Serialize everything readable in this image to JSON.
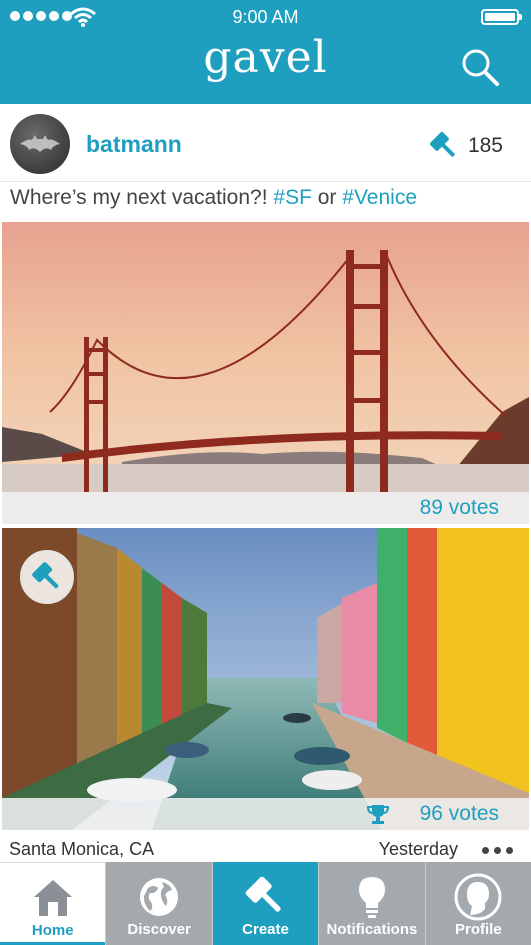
{
  "status_bar": {
    "time": "9:00 AM"
  },
  "app": {
    "name": "gavel",
    "accent": "#1e9fbf"
  },
  "post": {
    "username": "batmann",
    "gavel_count": "185",
    "caption_text": "Where’s my next vacation?! ",
    "tag1": "#SF",
    "caption_or": " or ",
    "tag2": "#Venice",
    "options": [
      {
        "subject": "Golden Gate Bridge, San Francisco",
        "votes": "89 votes",
        "winner": false
      },
      {
        "subject": "Colorful canal houses, Venice",
        "votes": "96 votes",
        "winner": true
      }
    ],
    "location": "Santa Monica, CA",
    "time": "Yesterday"
  },
  "tabs": [
    {
      "label": "Home",
      "icon": "house-icon",
      "active": true
    },
    {
      "label": "Discover",
      "icon": "globe-icon"
    },
    {
      "label": "Create",
      "icon": "gavel-icon"
    },
    {
      "label": "Notifications",
      "icon": "lightbulb-icon"
    },
    {
      "label": "Profile",
      "icon": "profile-head-icon"
    }
  ]
}
